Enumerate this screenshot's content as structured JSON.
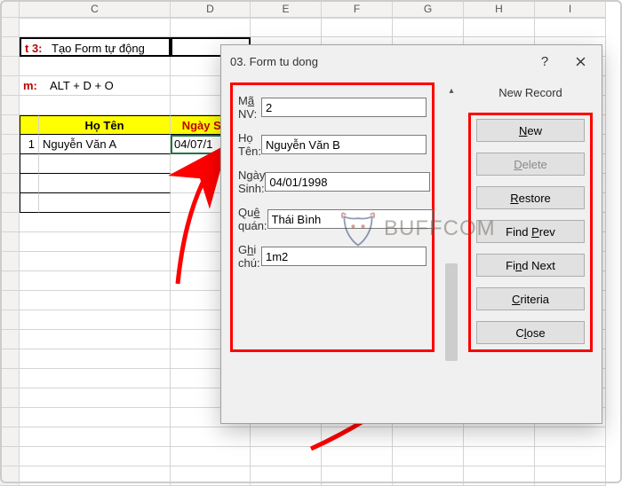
{
  "columns": [
    "C",
    "D",
    "E",
    "F",
    "G",
    "H",
    "I"
  ],
  "sheet": {
    "r3_left": "t 3:",
    "r3_text": "Tạo Form tự động",
    "r5_left": "m:",
    "r5_text": "ALT + D + O",
    "hdr_b": " ",
    "hdr_c": "Họ Tên",
    "hdr_d": "Ngày Sinh",
    "row1_b": "1",
    "row1_c": "Nguyễn Văn A",
    "row1_d": "04/07/1"
  },
  "dialog": {
    "title": "03. Form tu dong",
    "status": "New Record",
    "fields": [
      {
        "label": "Mã NV:",
        "value": "2",
        "underline": "a"
      },
      {
        "label": "Họ Tên:",
        "value": "Nguyễn Văn B"
      },
      {
        "label": "Ngày Sinh:",
        "value": "04/01/1998",
        "underline": "g"
      },
      {
        "label": "Quê quán:",
        "value": "Thái Bình",
        "underline": "e"
      },
      {
        "label": "Ghi chú:",
        "value": "1m2",
        "underline": "h"
      }
    ],
    "buttons": {
      "new": "New",
      "delete": "Delete",
      "restore": "Restore",
      "findprev": "Find Prev",
      "findnext": "Find Next",
      "criteria": "Criteria",
      "close": "Close"
    }
  },
  "watermark": "BUFFCOM"
}
